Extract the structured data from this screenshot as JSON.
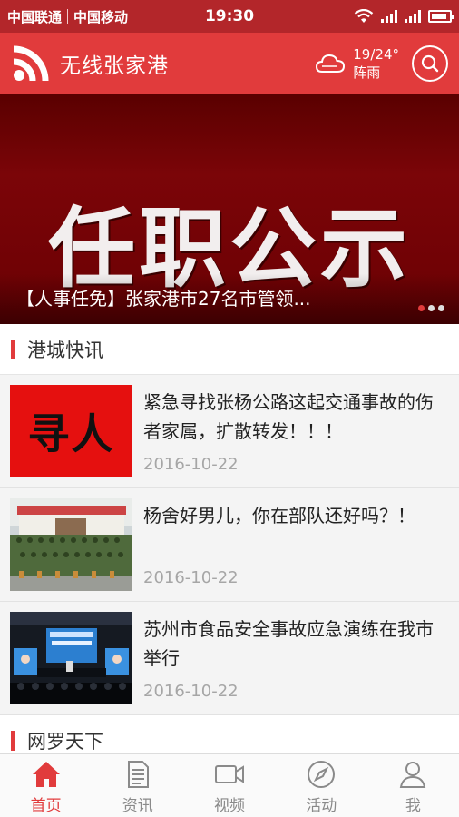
{
  "status_bar": {
    "carrier1": "中国联通",
    "carrier2": "中国移动",
    "time": "19:30",
    "battery_level": 0.9
  },
  "header": {
    "app_title": "无线张家港",
    "weather_temp": "19/24°",
    "weather_desc": "阵雨",
    "accent_color": "#e13b3c"
  },
  "banner": {
    "image_text": "任职公示",
    "caption": "【人事任免】张家港市27名市管领...",
    "slide_count": 3,
    "active_slide": 1
  },
  "sections": {
    "quick_news": "港城快讯",
    "world_news": "网罗天下"
  },
  "news": [
    {
      "title": "紧急寻找张杨公路这起交通事故的伤者家属，扩散转发！！！",
      "date": "2016-10-22",
      "thumb_text": "寻人"
    },
    {
      "title": "杨舍好男儿，你在部队还好吗？！",
      "date": "2016-10-22",
      "thumb_text": ""
    },
    {
      "title": "苏州市食品安全事故应急演练在我市举行",
      "date": "2016-10-22",
      "thumb_text": ""
    }
  ],
  "tabs": [
    {
      "label": "首页",
      "icon": "home-icon",
      "active": true
    },
    {
      "label": "资讯",
      "icon": "document-icon",
      "active": false
    },
    {
      "label": "视频",
      "icon": "video-camera-icon",
      "active": false
    },
    {
      "label": "活动",
      "icon": "compass-icon",
      "active": false
    },
    {
      "label": "我",
      "icon": "user-icon",
      "active": false
    }
  ]
}
